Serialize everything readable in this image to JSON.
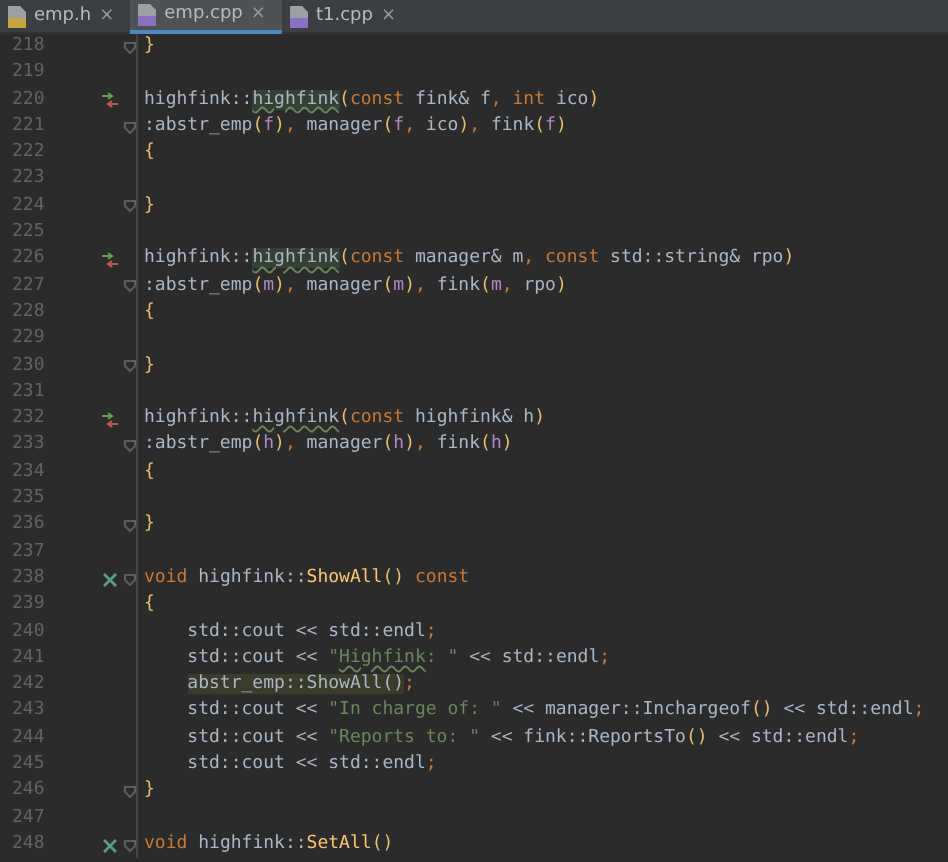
{
  "tabs": [
    {
      "label": "emp.h",
      "kind": "h",
      "close": "×",
      "selected": false
    },
    {
      "label": "emp.cpp",
      "kind": "cpp",
      "close": "×",
      "selected": true
    },
    {
      "label": "t1.cpp",
      "kind": "cpp",
      "close": "×",
      "selected": false
    }
  ],
  "lines": [
    {
      "number": "218",
      "kind": "plain",
      "fold": true,
      "indented": false,
      "tokens": [
        {
          "text": "}",
          "kind": "paren"
        }
      ]
    },
    {
      "number": "219",
      "kind": "plain",
      "fold": false,
      "indented": false
    },
    {
      "number": "220",
      "kind": "override",
      "fold": false,
      "indented": false,
      "tokens": [
        {
          "text": "highfink::",
          "kind": "plain"
        },
        {
          "text": "highfink",
          "kind": "hlwarn"
        },
        {
          "text": "(",
          "kind": "paren"
        },
        {
          "text": "const",
          "kind": "keyword"
        },
        {
          "text": " fink& f",
          "kind": "plain"
        },
        {
          "text": ", ",
          "kind": "keyword"
        },
        {
          "text": "int",
          "kind": "keyword"
        },
        {
          "text": " ico",
          "kind": "plain"
        },
        {
          "text": ")",
          "kind": "paren"
        }
      ]
    },
    {
      "number": "221",
      "kind": "plain",
      "fold": true,
      "indented": false,
      "tokens": [
        {
          "text": ":abstr_emp",
          "kind": "plain"
        },
        {
          "text": "(",
          "kind": "paren"
        },
        {
          "text": "f",
          "kind": "param"
        },
        {
          "text": ")",
          "kind": "paren"
        },
        {
          "text": ",",
          "kind": "keyword"
        },
        {
          "text": " manager",
          "kind": "plain"
        },
        {
          "text": "(",
          "kind": "paren"
        },
        {
          "text": "f",
          "kind": "param"
        },
        {
          "text": ",",
          "kind": "keyword"
        },
        {
          "text": " ico",
          "kind": "plain"
        },
        {
          "text": ")",
          "kind": "paren"
        },
        {
          "text": ",",
          "kind": "keyword"
        },
        {
          "text": " fink",
          "kind": "plain"
        },
        {
          "text": "(",
          "kind": "paren"
        },
        {
          "text": "f",
          "kind": "param"
        },
        {
          "text": ")",
          "kind": "paren"
        }
      ]
    },
    {
      "number": "222",
      "kind": "plain",
      "fold": false,
      "indented": false,
      "tokens": [
        {
          "text": "{",
          "kind": "paren"
        }
      ]
    },
    {
      "number": "223",
      "kind": "plain",
      "fold": false,
      "indented": false
    },
    {
      "number": "224",
      "kind": "plain",
      "fold": true,
      "indented": false,
      "tokens": [
        {
          "text": "}",
          "kind": "paren"
        }
      ]
    },
    {
      "number": "225",
      "kind": "plain",
      "fold": false,
      "indented": false
    },
    {
      "number": "226",
      "kind": "override",
      "fold": false,
      "indented": false,
      "tokens": [
        {
          "text": "highfink::",
          "kind": "plain"
        },
        {
          "text": "highfink",
          "kind": "hlwarn"
        },
        {
          "text": "(",
          "kind": "paren"
        },
        {
          "text": "const",
          "kind": "keyword"
        },
        {
          "text": " manager& m",
          "kind": "plain"
        },
        {
          "text": ", ",
          "kind": "keyword"
        },
        {
          "text": "const",
          "kind": "keyword"
        },
        {
          "text": " std::string& rpo",
          "kind": "plain"
        },
        {
          "text": ")",
          "kind": "paren"
        }
      ]
    },
    {
      "number": "227",
      "kind": "plain",
      "fold": true,
      "indented": false,
      "tokens": [
        {
          "text": ":abstr_emp",
          "kind": "plain"
        },
        {
          "text": "(",
          "kind": "paren"
        },
        {
          "text": "m",
          "kind": "param"
        },
        {
          "text": ")",
          "kind": "paren"
        },
        {
          "text": ",",
          "kind": "keyword"
        },
        {
          "text": " manager",
          "kind": "plain"
        },
        {
          "text": "(",
          "kind": "paren"
        },
        {
          "text": "m",
          "kind": "param"
        },
        {
          "text": ")",
          "kind": "paren"
        },
        {
          "text": ",",
          "kind": "keyword"
        },
        {
          "text": " fink",
          "kind": "plain"
        },
        {
          "text": "(",
          "kind": "paren"
        },
        {
          "text": "m",
          "kind": "param"
        },
        {
          "text": ",",
          "kind": "keyword"
        },
        {
          "text": " rpo",
          "kind": "plain"
        },
        {
          "text": ")",
          "kind": "paren"
        }
      ]
    },
    {
      "number": "228",
      "kind": "plain",
      "fold": false,
      "indented": false,
      "tokens": [
        {
          "text": "{",
          "kind": "paren"
        }
      ]
    },
    {
      "number": "229",
      "kind": "plain",
      "fold": false,
      "indented": false
    },
    {
      "number": "230",
      "kind": "plain",
      "fold": true,
      "indented": false,
      "tokens": [
        {
          "text": "}",
          "kind": "paren"
        }
      ]
    },
    {
      "number": "231",
      "kind": "plain",
      "fold": false,
      "indented": false
    },
    {
      "number": "232",
      "kind": "override",
      "fold": false,
      "indented": false,
      "tokens": [
        {
          "text": "highfink::",
          "kind": "plain"
        },
        {
          "text": "highfink",
          "kind": "warn"
        },
        {
          "text": "(",
          "kind": "paren"
        },
        {
          "text": "const",
          "kind": "keyword"
        },
        {
          "text": " highfink& h",
          "kind": "plain"
        },
        {
          "text": ")",
          "kind": "paren"
        }
      ]
    },
    {
      "number": "233",
      "kind": "plain",
      "fold": true,
      "indented": false,
      "tokens": [
        {
          "text": ":abstr_emp",
          "kind": "plain"
        },
        {
          "text": "(",
          "kind": "paren"
        },
        {
          "text": "h",
          "kind": "param"
        },
        {
          "text": ")",
          "kind": "paren"
        },
        {
          "text": ",",
          "kind": "keyword"
        },
        {
          "text": " manager",
          "kind": "plain"
        },
        {
          "text": "(",
          "kind": "paren"
        },
        {
          "text": "h",
          "kind": "param"
        },
        {
          "text": ")",
          "kind": "paren"
        },
        {
          "text": ",",
          "kind": "keyword"
        },
        {
          "text": " fink",
          "kind": "plain"
        },
        {
          "text": "(",
          "kind": "paren"
        },
        {
          "text": "h",
          "kind": "param"
        },
        {
          "text": ")",
          "kind": "paren"
        }
      ]
    },
    {
      "number": "234",
      "kind": "plain",
      "fold": false,
      "indented": false,
      "tokens": [
        {
          "text": "{",
          "kind": "paren"
        }
      ]
    },
    {
      "number": "235",
      "kind": "plain",
      "fold": false,
      "indented": false
    },
    {
      "number": "236",
      "kind": "plain",
      "fold": true,
      "indented": false,
      "tokens": [
        {
          "text": "}",
          "kind": "paren"
        }
      ]
    },
    {
      "number": "237",
      "kind": "plain",
      "fold": false,
      "indented": false
    },
    {
      "number": "238",
      "kind": "implement",
      "fold": true,
      "indented": false,
      "tokens": [
        {
          "text": "void",
          "kind": "keyword"
        },
        {
          "text": " highfink::",
          "kind": "plain"
        },
        {
          "text": "ShowAll",
          "kind": "func"
        },
        {
          "text": "()",
          "kind": "paren"
        },
        {
          "text": " const",
          "kind": "keyword"
        }
      ]
    },
    {
      "number": "239",
      "kind": "plain",
      "fold": false,
      "indented": false,
      "tokens": [
        {
          "text": "{",
          "kind": "paren"
        }
      ]
    },
    {
      "number": "240",
      "kind": "plain",
      "fold": false,
      "indented": true,
      "tokens": [
        {
          "text": "std::cout << std::endl",
          "kind": "plain"
        },
        {
          "text": ";",
          "kind": "keyword"
        }
      ]
    },
    {
      "number": "241",
      "kind": "plain",
      "fold": false,
      "indented": true,
      "tokens": [
        {
          "text": "std::cout << ",
          "kind": "plain"
        },
        {
          "text": "\"",
          "kind": "string"
        },
        {
          "text": "Highfink",
          "kind": "typo"
        },
        {
          "text": ": \"",
          "kind": "string"
        },
        {
          "text": " << std::endl",
          "kind": "plain"
        },
        {
          "text": ";",
          "kind": "keyword"
        }
      ]
    },
    {
      "number": "242",
      "kind": "plain",
      "fold": false,
      "indented": true,
      "tokens": [
        {
          "text": "abstr_emp::ShowAll()",
          "kind": "hl"
        },
        {
          "text": ";",
          "kind": "keyword"
        }
      ]
    },
    {
      "number": "243",
      "kind": "plain",
      "fold": false,
      "indented": true,
      "tokens": [
        {
          "text": "std::cout << ",
          "kind": "plain"
        },
        {
          "text": "\"In charge of: \"",
          "kind": "string"
        },
        {
          "text": " << manager::Inchargeof",
          "kind": "plain"
        },
        {
          "text": "()",
          "kind": "paren"
        },
        {
          "text": " << std::endl",
          "kind": "plain"
        },
        {
          "text": ";",
          "kind": "keyword"
        }
      ]
    },
    {
      "number": "244",
      "kind": "plain",
      "fold": false,
      "indented": true,
      "tokens": [
        {
          "text": "std::cout << ",
          "kind": "plain"
        },
        {
          "text": "\"Reports to: \"",
          "kind": "string"
        },
        {
          "text": " << fink::ReportsTo",
          "kind": "plain"
        },
        {
          "text": "()",
          "kind": "paren"
        },
        {
          "text": " << std::endl",
          "kind": "plain"
        },
        {
          "text": ";",
          "kind": "keyword"
        }
      ]
    },
    {
      "number": "245",
      "kind": "plain",
      "fold": false,
      "indented": true,
      "tokens": [
        {
          "text": "std::cout << std::endl",
          "kind": "plain"
        },
        {
          "text": ";",
          "kind": "keyword"
        }
      ]
    },
    {
      "number": "246",
      "kind": "plain",
      "fold": true,
      "indented": false,
      "tokens": [
        {
          "text": "}",
          "kind": "paren"
        }
      ]
    },
    {
      "number": "247",
      "kind": "plain",
      "fold": false,
      "indented": false
    },
    {
      "number": "248",
      "kind": "implement",
      "fold": true,
      "indented": false,
      "tokens": [
        {
          "text": "void",
          "kind": "keyword"
        },
        {
          "text": " highfink::",
          "kind": "plain"
        },
        {
          "text": "SetAll",
          "kind": "func"
        },
        {
          "text": "()",
          "kind": "paren"
        }
      ]
    }
  ]
}
